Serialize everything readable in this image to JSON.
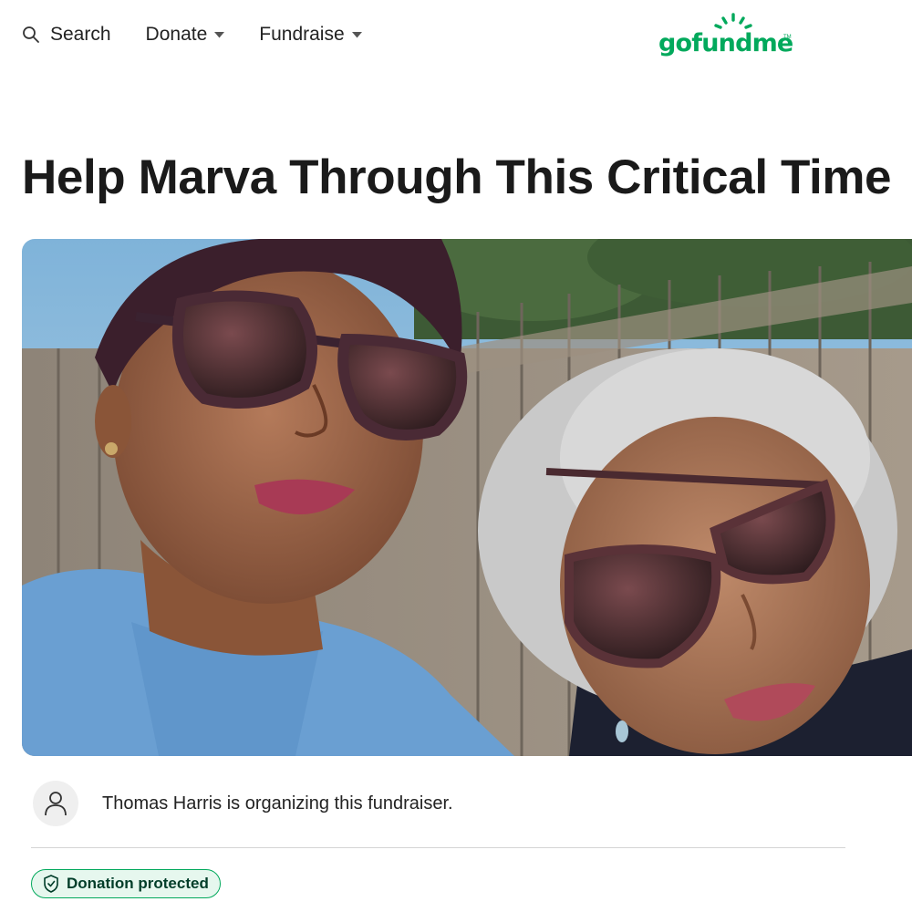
{
  "header": {
    "search_label": "Search",
    "donate_label": "Donate",
    "fundraise_label": "Fundraise",
    "logo_text": "gofundme",
    "logo_tm": "TM",
    "brand_color": "#02a95c"
  },
  "campaign": {
    "title": "Help Marva Through This Critical Time",
    "organizer_text": "Thomas Harris is organizing this fundraiser.",
    "badge_label": "Donation protected"
  },
  "icons": {
    "search": "search-icon",
    "caret": "chevron-down-icon",
    "person": "person-icon",
    "shield": "shield-check-icon"
  }
}
